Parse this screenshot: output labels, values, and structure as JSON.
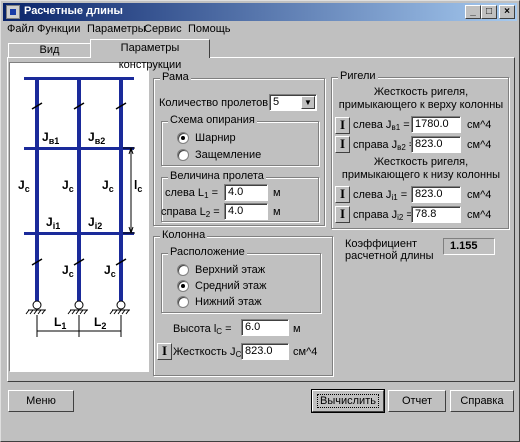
{
  "window": {
    "title": "Расчетные длины",
    "minimize": "_",
    "maximize": "□",
    "close": "×"
  },
  "menu": [
    "Файл",
    "Функции",
    "Параметры",
    "Сервис",
    "Помощь"
  ],
  "tabs": [
    {
      "label": "Вид конструкции",
      "active": false
    },
    {
      "label": "Параметры конструкции",
      "active": true
    }
  ],
  "schematic": {
    "label_j_b1": "J",
    "label_j_b1_sub": "в1",
    "label_j_b2": "J",
    "label_j_b2_sub": "в2",
    "label_jc": "J",
    "label_jc_sub": "c",
    "label_lc": "l",
    "label_lc_sub": "c",
    "label_j_i1": "J",
    "label_j_i1_sub": "i1",
    "label_j_i2": "J",
    "label_j_i2_sub": "i2",
    "label_l1": "L",
    "label_l1_sub": "1",
    "label_l2": "L",
    "label_l2_sub": "2"
  },
  "frame": {
    "title": "Рама",
    "spans_label": "Количество пролетов k =",
    "spans_value": "5",
    "support": {
      "title": "Схема опирания",
      "options": [
        {
          "label": "Шарнир",
          "selected": true
        },
        {
          "label": "Защемление",
          "selected": false
        }
      ]
    },
    "span": {
      "title": "Величина пролета",
      "left_label": "слева  L",
      "left_sub": "1",
      "left_value": "4.0",
      "right_label": "справа L",
      "right_sub": "2",
      "right_value": "4.0",
      "unit": "м"
    }
  },
  "beams": {
    "title": "Ригели",
    "top_caption": "Жесткость ригеля, примыкающего к верху колонны",
    "top_left_label": "слева  J",
    "top_left_sub": "в1",
    "top_left_value": "1780.0",
    "top_right_label": "справа J",
    "top_right_sub": "в2",
    "top_right_value": "823.0",
    "bottom_caption": "Жесткость ригеля, примыкающего к низу колонны",
    "bottom_left_label": "слева  J",
    "bottom_left_sub": "i1",
    "bottom_left_value": "823.0",
    "bottom_right_label": "справа J",
    "bottom_right_sub": "i2",
    "bottom_right_value": "78.8",
    "unit": "см^4",
    "icon_glyph": "I"
  },
  "column": {
    "title": "Колонна",
    "location": {
      "title": "Расположение",
      "options": [
        {
          "label": "Верхний этаж",
          "selected": false
        },
        {
          "label": "Средний этаж",
          "selected": true
        },
        {
          "label": "Нижний этаж",
          "selected": false
        }
      ]
    },
    "height_label": "Высота   l",
    "height_sub": "C",
    "height_eq": "=",
    "height_value": "6.0",
    "height_unit": "м",
    "stiffness_label": "Жесткость J",
    "stiffness_sub": "C",
    "stiffness_eq": "=",
    "stiffness_value": "823.0",
    "stiffness_unit": "см^4"
  },
  "coefficient": {
    "label_line1": "Коэффициент",
    "label_line2": "расчетной длины",
    "value": "1.155"
  },
  "buttons": {
    "menu": "Меню",
    "compute": "Вычислить",
    "report": "Отчет",
    "help": "Справка"
  }
}
